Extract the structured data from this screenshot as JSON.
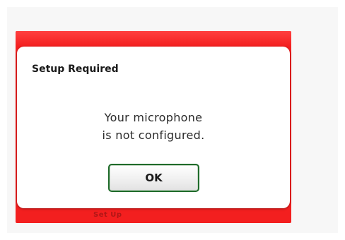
{
  "background_window": {
    "accent_color": "#f31f1f",
    "obscured_label": "Set Up"
  },
  "dialog": {
    "title": "Setup Required",
    "message_lines": [
      "Your microphone",
      "is not configured."
    ],
    "ok_button_label": "OK",
    "ok_button_border_color": "#1f6b2a"
  }
}
